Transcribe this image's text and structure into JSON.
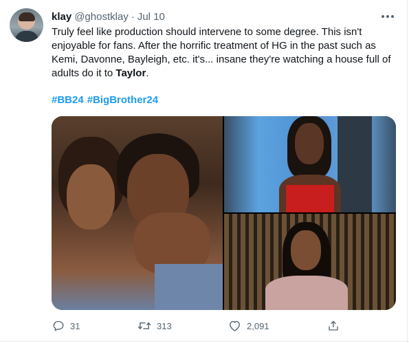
{
  "author": {
    "name": "klay",
    "handle": "@ghostklay",
    "separator": "·",
    "date": "Jul 10"
  },
  "tweet": {
    "text_before_bold": "Truly feel like production should intervene to some degree. This isn't enjoyable for fans. After the horrific treatment of HG in the past such as Kemi, Davonne, Bayleigh, etc. it's... insane they're watching a house full of adults do it to ",
    "bold_name": "Taylor",
    "text_after_bold": ".",
    "hashtags": [
      "#BB24",
      "#BigBrother24"
    ]
  },
  "actions": {
    "reply_count": "31",
    "retweet_count": "313",
    "like_count": "2,091",
    "share_icon": "share-icon"
  },
  "colors": {
    "link": "#1d9bf0",
    "secondary_text": "#536471",
    "primary_text": "#0f1419"
  }
}
